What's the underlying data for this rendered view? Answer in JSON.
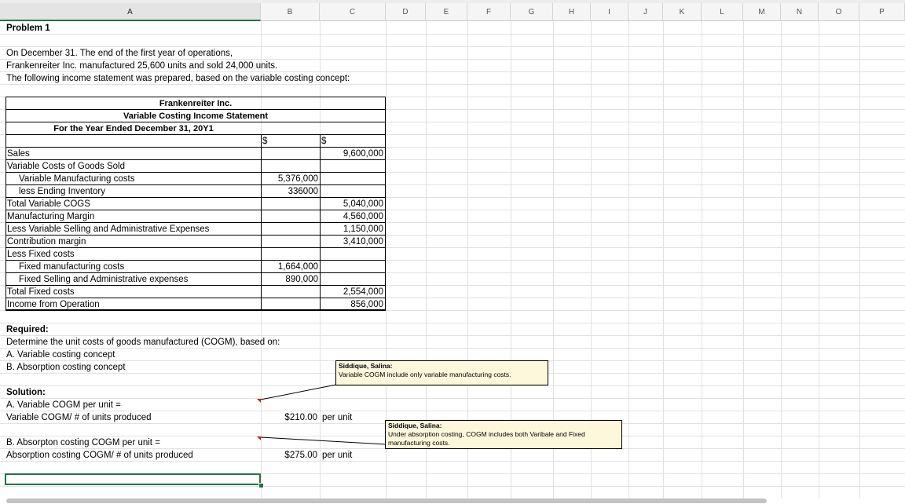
{
  "columns": [
    "A",
    "B",
    "C",
    "D",
    "E",
    "F",
    "G",
    "H",
    "I",
    "J",
    "K",
    "L",
    "M",
    "N",
    "O",
    "P"
  ],
  "selected_column": "A",
  "title": "Problem 1",
  "intro": [
    "On December 31. The end of the first year of operations,",
    "Frankenreiter Inc. manufactured 25,600 units and sold 24,000 units.",
    "The following income statement was prepared, based on the variable costing concept:"
  ],
  "statement": {
    "company": "Frankenreiter Inc.",
    "name": "Variable Costing Income Statement",
    "period": "For the Year Ended December 31, 20Y1",
    "currency_b": "$",
    "currency_c": "$",
    "rows": [
      {
        "label": "Sales",
        "b": "",
        "c": "9,600,000",
        "indent": false
      },
      {
        "label": "Variable Costs of Goods Sold",
        "b": "",
        "c": "",
        "indent": false
      },
      {
        "label": "Variable Manufacturing costs",
        "b": "5,376,000",
        "c": "",
        "indent": true
      },
      {
        "label": "less Ending Inventory",
        "b": "336000",
        "c": "",
        "indent": true
      },
      {
        "label": "Total Variable COGS",
        "b": "",
        "c": "5,040,000",
        "indent": false
      },
      {
        "label": "Manufacturing Margin",
        "b": "",
        "c": "4,560,000",
        "indent": false
      },
      {
        "label": "Less Variable Selling and Administrative Expenses",
        "b": "",
        "c": "1,150,000",
        "indent": false
      },
      {
        "label": "Contribution margin",
        "b": "",
        "c": "3,410,000",
        "indent": false
      },
      {
        "label": "Less Fixed costs",
        "b": "",
        "c": "",
        "indent": false
      },
      {
        "label": "Fixed manufacturing costs",
        "b": "1,664,000",
        "c": "",
        "indent": true
      },
      {
        "label": "Fixed Selling and Administrative expenses",
        "b": "890,000",
        "c": "",
        "indent": true
      },
      {
        "label": "Total Fixed costs",
        "b": "",
        "c": "2,554,000",
        "indent": false
      },
      {
        "label": "Income from Operation",
        "b": "",
        "c": "856,000",
        "indent": false
      }
    ]
  },
  "required": {
    "heading": "Required:",
    "lines": [
      "Determine the unit costs of goods manufactured (COGM), based on:",
      "A. Variable costing concept",
      "B. Absorption costing concept"
    ]
  },
  "solution": {
    "heading": "Solution:",
    "a_line1": "A. Variable COGM per unit =",
    "a_line2": "Variable COGM/ # of units produced",
    "a_value": "$210.00",
    "a_unit": "per unit",
    "b_line1": "B. Absorpton costing COGM per unit =",
    "b_line2": "Absorption costing COGM/ # of units produced",
    "b_value": "$275.00",
    "b_unit": "per unit"
  },
  "comments": [
    {
      "author": "Siddique, Salina:",
      "text": "Variable COGM include only variable manufacturing costs."
    },
    {
      "author": "Siddique, Salina:",
      "text": "Under absorption costing, COGM includes both Varibale and Fixed manufacturing costs."
    }
  ],
  "colors": {
    "selection": "#217346",
    "comment_bg": "#fdf7dc",
    "indicator": "#d21f1f"
  }
}
